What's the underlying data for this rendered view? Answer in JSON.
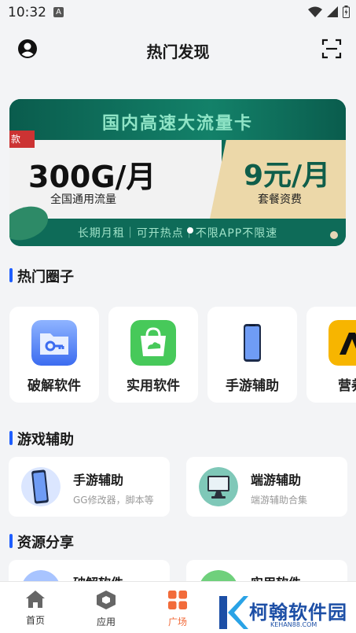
{
  "status_bar": {
    "time": "10:32",
    "notif_letter": "A"
  },
  "header": {
    "title": "热门发现"
  },
  "banner": {
    "headline": "国内高速大流量卡",
    "tag": "款",
    "left_big": "300G/月",
    "left_sub": "全国通用流量",
    "right_big": "9元/月",
    "right_sub": "套餐资费",
    "bottom_line": "长期月租｜可开热点｜不限APP不限速"
  },
  "sections": {
    "hot_circles": "热门圈子",
    "game_assist": "游戏辅助",
    "resource_share": "资源分享"
  },
  "circles": [
    {
      "label": "破解软件",
      "icon": "key-folder-icon"
    },
    {
      "label": "实用软件",
      "icon": "shopping-bag-icon"
    },
    {
      "label": "手游辅助",
      "icon": "phone-icon"
    },
    {
      "label": "营养",
      "icon": "yellow-app-icon"
    }
  ],
  "game_tools": [
    {
      "name": "手游辅助",
      "desc": "GG修改器，脚本等",
      "icon": "phone-icon"
    },
    {
      "name": "端游辅助",
      "desc": "端游辅助合集",
      "icon": "monitor-icon"
    }
  ],
  "resource_tools": [
    {
      "name": "破解软件",
      "icon": "key-folder-icon"
    },
    {
      "name": "实用软件",
      "icon": "shopping-bag-icon"
    }
  ],
  "tabbar": {
    "home": "首页",
    "apps": "应用",
    "square": "广场"
  },
  "watermark": {
    "title": "柯翰软件园",
    "domain": "KEHAN88.COM"
  },
  "colors": {
    "accent": "#f26b3a",
    "section_bar": "#1e5eff"
  }
}
